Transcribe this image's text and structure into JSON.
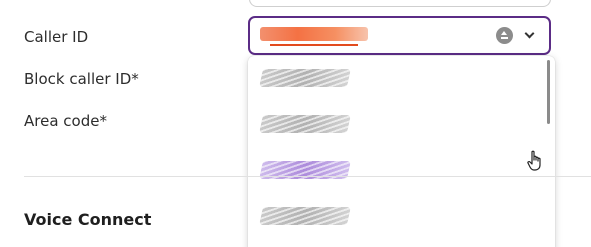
{
  "form": {
    "caller_id_label": "Caller ID",
    "block_caller_id_label": "Block caller ID*",
    "area_code_label": "Area code*"
  },
  "caller_id_select": {
    "selected_value": "",
    "clear_icon": "clear-icon",
    "open_icon": "chevron-down-icon",
    "border_color": "#5b2c86"
  },
  "dropdown": {
    "options": [
      {
        "label": "",
        "highlighted": false
      },
      {
        "label": "",
        "highlighted": false
      },
      {
        "label": "",
        "highlighted": true
      },
      {
        "label": "",
        "highlighted": false
      }
    ]
  },
  "section": {
    "title": "Voice Connect"
  },
  "colors": {
    "accent": "#5b2c86",
    "highlight": "#a47fd8"
  }
}
